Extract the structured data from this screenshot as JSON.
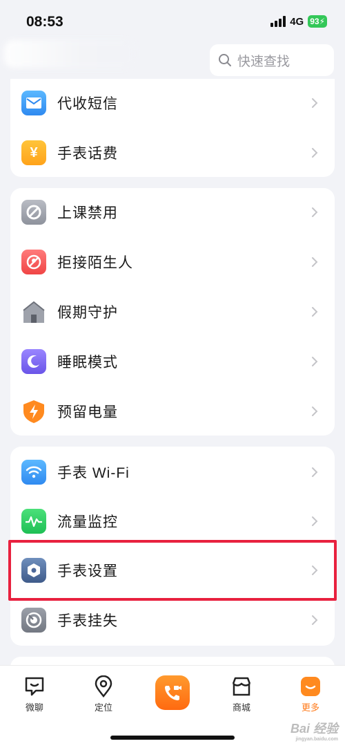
{
  "status_bar": {
    "time": "08:53",
    "network": "4G",
    "battery": "93"
  },
  "header": {
    "search_placeholder": "快速查找"
  },
  "card1": {
    "items": [
      {
        "label": "代收短信",
        "icon": "envelope-icon"
      },
      {
        "label": "手表话费",
        "icon": "yen-icon"
      }
    ]
  },
  "card2": {
    "items": [
      {
        "label": "上课禁用",
        "icon": "watch-disabled-icon"
      },
      {
        "label": "拒接陌生人",
        "icon": "block-stranger-icon"
      },
      {
        "label": "假期守护",
        "icon": "house-icon"
      },
      {
        "label": "睡眠模式",
        "icon": "moon-icon"
      },
      {
        "label": "预留电量",
        "icon": "lightning-icon"
      }
    ]
  },
  "card3": {
    "items": [
      {
        "label": "手表 Wi-Fi",
        "icon": "wifi-icon"
      },
      {
        "label": "流量监控",
        "icon": "pulse-icon"
      },
      {
        "label": "手表设置",
        "icon": "settings-hex-icon"
      },
      {
        "label": "手表挂失",
        "icon": "lost-report-icon"
      }
    ]
  },
  "bottom_nav": {
    "items": [
      {
        "label": "微聊",
        "icon": "chat-icon"
      },
      {
        "label": "定位",
        "icon": "location-pin-icon"
      },
      {
        "label": "商城",
        "icon": "store-icon"
      },
      {
        "label": "更多",
        "icon": "more-icon"
      }
    ],
    "active": "更多"
  },
  "watermark": {
    "text": "Bai 经验",
    "sub": "jingyan.baidu.com"
  }
}
